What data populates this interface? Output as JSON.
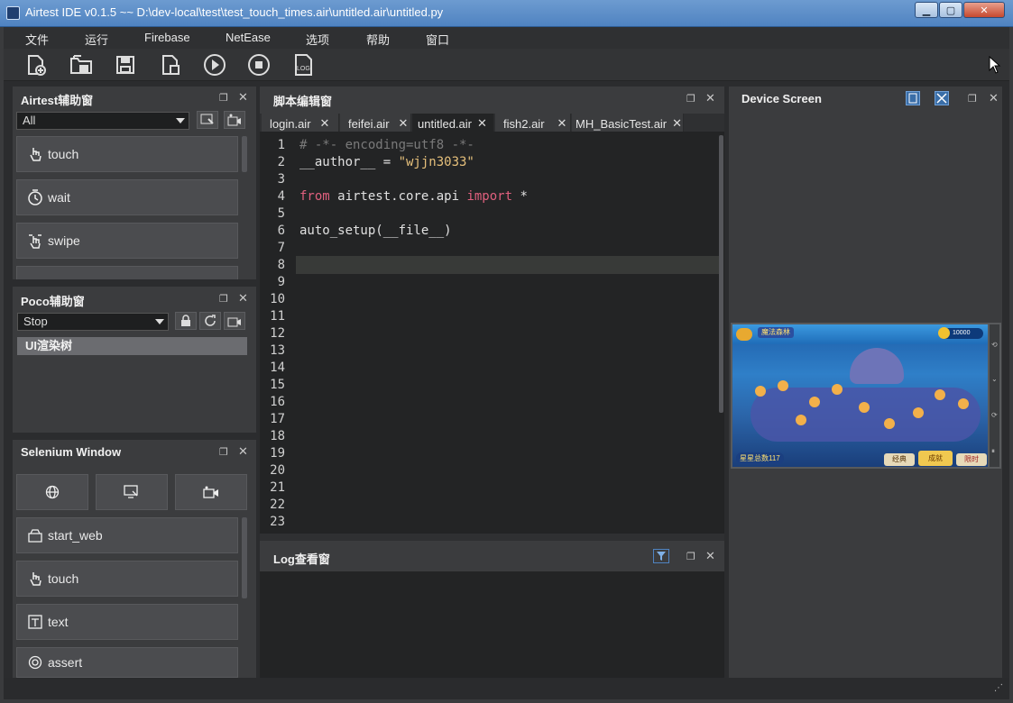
{
  "window": {
    "title": "Airtest IDE v0.1.5 ~~ D:\\dev-local\\test\\test_touch_times.air\\untitled.air\\untitled.py"
  },
  "menu": [
    "文件",
    "运行",
    "Firebase",
    "NetEase",
    "选项",
    "帮助",
    "窗口"
  ],
  "toolbar": [
    "new-file-icon",
    "open-folder-icon",
    "save-icon",
    "save-as-icon",
    "run-icon",
    "stop-icon",
    "log-icon"
  ],
  "airtest_panel": {
    "title": "Airtest辅助窗",
    "filter": "All",
    "items": [
      "touch",
      "wait",
      "swipe"
    ]
  },
  "poco_panel": {
    "title": "Poco辅助窗",
    "mode": "Stop",
    "tree_root": "UI渲染树"
  },
  "selenium_panel": {
    "title": "Selenium Window",
    "items": [
      "start_web",
      "touch",
      "text",
      "assert"
    ]
  },
  "editor_panel": {
    "title": "脚本编辑窗",
    "tabs": [
      "login.air",
      "feifei.air",
      "untitled.air",
      "fish2.air",
      "MH_BasicTest.air"
    ],
    "active_tab": "untitled.air",
    "line_numbers": [
      "1",
      "2",
      "3",
      "4",
      "5",
      "6",
      "7",
      "8",
      "9",
      "10",
      "11",
      "12",
      "13",
      "14",
      "15",
      "16",
      "17",
      "18",
      "19",
      "20",
      "21",
      "22",
      "23"
    ],
    "code": {
      "l1": "# -*- encoding=utf8 -*-",
      "l2_a": "__author__ = ",
      "l2_b": "\"wjjn3033\"",
      "l4_from": "from",
      "l4_mod": " airtest.core.api ",
      "l4_imp": "import",
      "l4_star": " *",
      "l6": "auto_setup(__file__)"
    }
  },
  "log_panel": {
    "title": "Log查看窗"
  },
  "device_panel": {
    "title": "Device Screen",
    "game": {
      "coins": "10000",
      "stars": "星星总数117",
      "btn1": "经典",
      "btn2": "成就",
      "btn3": "限时",
      "level_title": "魔法森林"
    }
  },
  "colors": {
    "accent": "#4f83c1",
    "keyword": "#e0607e",
    "string": "#e6c07b",
    "comment": "#7a7a7a"
  }
}
